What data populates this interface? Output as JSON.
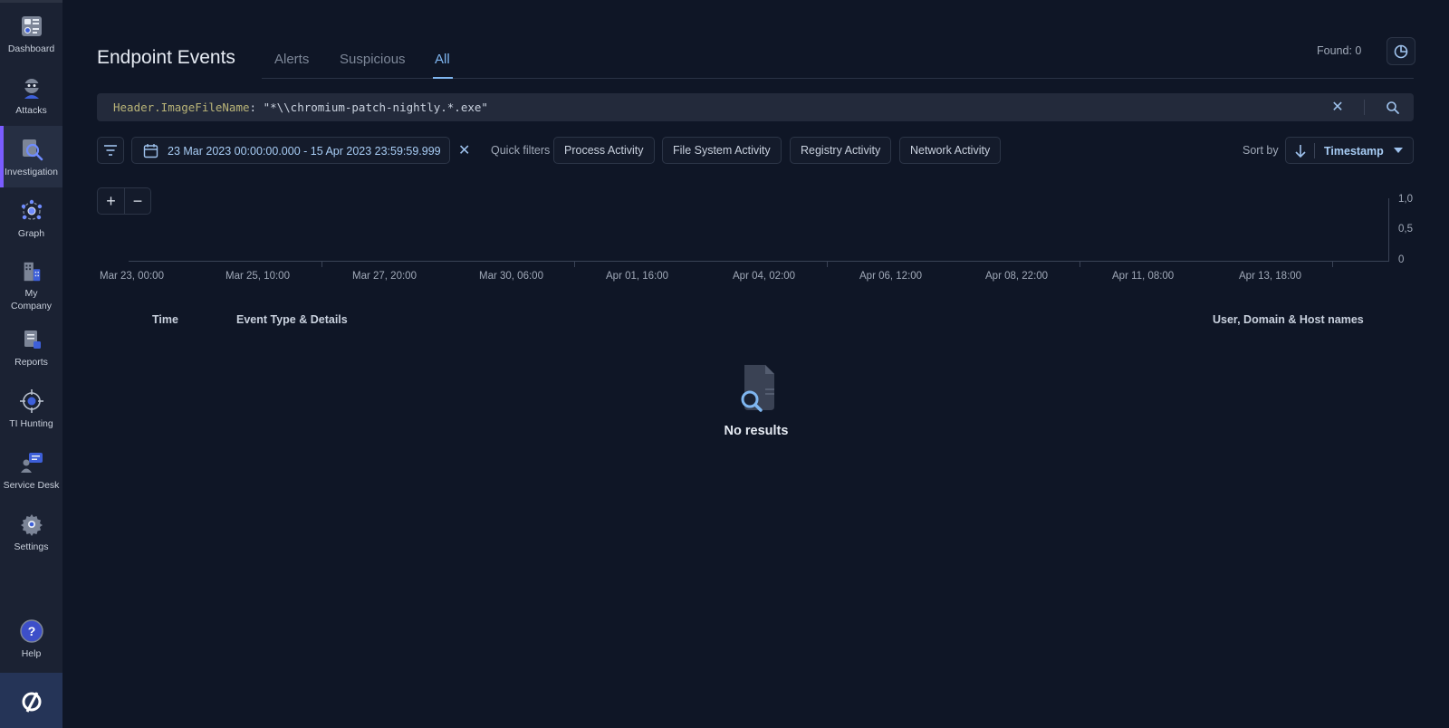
{
  "sidebar": {
    "items": [
      {
        "label": "Dashboard",
        "icon": "dashboard-icon"
      },
      {
        "label": "Attacks",
        "icon": "attacks-icon"
      },
      {
        "label": "Investigation",
        "icon": "investigation-icon",
        "active": true
      },
      {
        "label": "Graph",
        "icon": "graph-icon"
      },
      {
        "label": "My Company",
        "icon": "company-icon"
      },
      {
        "label": "Reports",
        "icon": "reports-icon"
      },
      {
        "label": "TI Hunting",
        "icon": "target-icon"
      },
      {
        "label": "Service Desk",
        "icon": "service-desk-icon"
      },
      {
        "label": "Settings",
        "icon": "gear-icon"
      }
    ],
    "help": {
      "label": "Help",
      "icon": "help-icon"
    },
    "logo_icon": "brand-logo-icon"
  },
  "header": {
    "title": "Endpoint Events",
    "tabs": [
      {
        "label": "Alerts"
      },
      {
        "label": "Suspicious"
      },
      {
        "label": "All",
        "active": true
      }
    ],
    "found": "Found: 0"
  },
  "query": {
    "key": "Header.ImageFileName",
    "colon": ":",
    "value": " \"*\\\\chromium-patch-nightly.*.exe\""
  },
  "filters": {
    "date_range": "23 Mar 2023 00:00:00.000 - 15 Apr 2023 23:59:59.999",
    "quick_filters_label": "Quick filters",
    "chips": [
      "Process Activity",
      "File System Activity",
      "Registry Activity",
      "Network Activity"
    ],
    "sort_label": "Sort by",
    "sort_value": "Timestamp"
  },
  "histogram": {
    "y_ticks": [
      "1,0",
      "0,5",
      "0"
    ],
    "x_labels": [
      "Mar 23, 00:00",
      "Mar 25, 10:00",
      "Mar 27, 20:00",
      "Mar 30, 06:00",
      "Apr 01, 16:00",
      "Apr 04, 02:00",
      "Apr 06, 12:00",
      "Apr 08, 22:00",
      "Apr 11, 08:00",
      "Apr 13, 18:00"
    ]
  },
  "table": {
    "columns": [
      "Time",
      "Event Type & Details",
      "User, Domain & Host names"
    ],
    "empty_text": "No results"
  },
  "colors": {
    "background": "#0f1626",
    "sidebar": "#1b2233",
    "accent": "#7fb6f0",
    "active_indicator": "#7a5cff"
  }
}
